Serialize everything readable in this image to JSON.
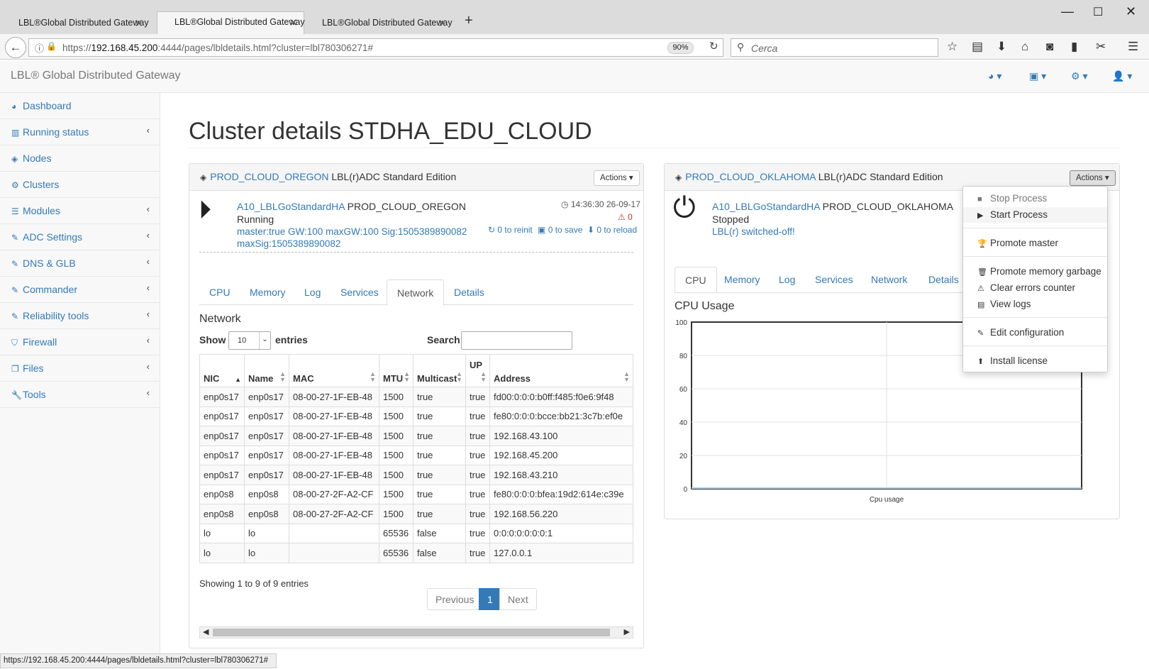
{
  "browser": {
    "tabs": [
      "LBL®Global Distributed Gateway",
      "LBL®Global Distributed Gateway",
      "LBL®Global Distributed Gateway"
    ],
    "url_prefix": "https://",
    "url_host": "192.168.45.200",
    "url_rest": ":4444/pages/lbldetails.html?cluster=lbl780306271#",
    "zoom": "90%",
    "search_placeholder": "Cerca",
    "status_url": "https://192.168.45.200:4444/pages/lbldetails.html?cluster=lbl780306271#"
  },
  "app": {
    "brand": "LBL® Global Distributed Gateway"
  },
  "sidebar": {
    "items": [
      {
        "label": "Dashboard",
        "icon": "dashboard-icon"
      },
      {
        "label": "Running status",
        "icon": "bar-chart-icon"
      },
      {
        "label": "Nodes",
        "icon": "cube-icon"
      },
      {
        "label": "Clusters",
        "icon": "cogs-icon"
      },
      {
        "label": "Modules",
        "icon": "list-icon"
      },
      {
        "label": "ADC Settings",
        "icon": "edit-icon"
      },
      {
        "label": "DNS & GLB",
        "icon": "edit-icon"
      },
      {
        "label": "Commander",
        "icon": "edit-icon"
      },
      {
        "label": "Reliability tools",
        "icon": "edit-icon"
      },
      {
        "label": "Firewall",
        "icon": "shield-icon"
      },
      {
        "label": "Files",
        "icon": "files-icon"
      },
      {
        "label": "Tools",
        "icon": "wrench-icon"
      }
    ]
  },
  "page": {
    "title": "Cluster details STDHA_EDU_CLOUD"
  },
  "left_panel": {
    "name": "PROD_CLOUD_OREGON",
    "edition": "LBL(r)ADC Standard Edition",
    "actions_label": "Actions",
    "node_link": "A10_LBLGoStandardHA",
    "node_name": "PROD_CLOUD_OREGON",
    "state": "Running",
    "info_line1": "master:true GW:100 maxGW:100 Sig:1505389890082",
    "info_line2": "maxSig:1505389890082",
    "timestamp": "14:36:30 26-09-17",
    "warnings": "0",
    "reinit": "0 to reinit",
    "save": "0 to save",
    "reload": "0 to reload",
    "tabs": [
      "CPU",
      "Memory",
      "Log",
      "Services",
      "Network",
      "Details"
    ],
    "section_title": "Network",
    "show_label": "Show",
    "entries_value": "10",
    "entries_label": "entries",
    "search_label": "Search:",
    "columns": [
      "NIC",
      "Name",
      "MAC",
      "MTU",
      "Multicast",
      "UP",
      "Address"
    ],
    "rows": [
      [
        "enp0s17",
        "enp0s17",
        "08-00-27-1F-EB-48",
        "1500",
        "true",
        "true",
        "fd00:0:0:0:b0ff:f485:f0e6:9f48"
      ],
      [
        "enp0s17",
        "enp0s17",
        "08-00-27-1F-EB-48",
        "1500",
        "true",
        "true",
        "fe80:0:0:0:bcce:bb21:3c7b:ef0e"
      ],
      [
        "enp0s17",
        "enp0s17",
        "08-00-27-1F-EB-48",
        "1500",
        "true",
        "true",
        "192.168.43.100"
      ],
      [
        "enp0s17",
        "enp0s17",
        "08-00-27-1F-EB-48",
        "1500",
        "true",
        "true",
        "192.168.45.200"
      ],
      [
        "enp0s17",
        "enp0s17",
        "08-00-27-1F-EB-48",
        "1500",
        "true",
        "true",
        "192.168.43.210"
      ],
      [
        "enp0s8",
        "enp0s8",
        "08-00-27-2F-A2-CF",
        "1500",
        "true",
        "true",
        "fe80:0:0:0:bfea:19d2:614e:c39e"
      ],
      [
        "enp0s8",
        "enp0s8",
        "08-00-27-2F-A2-CF",
        "1500",
        "true",
        "true",
        "192.168.56.220"
      ],
      [
        "lo",
        "lo",
        "",
        "65536",
        "false",
        "true",
        "0:0:0:0:0:0:0:1"
      ],
      [
        "lo",
        "lo",
        "",
        "65536",
        "false",
        "true",
        "127.0.0.1"
      ]
    ],
    "showing": "Showing 1 to 9 of 9 entries",
    "pager": {
      "previous": "Previous",
      "current": "1",
      "next": "Next"
    }
  },
  "right_panel": {
    "name": "PROD_CLOUD_OKLAHOMA",
    "edition": "LBL(r)ADC Standard Edition",
    "actions_label": "Actions",
    "node_link": "A10_LBLGoStandardHA",
    "node_name": "PROD_CLOUD_OKLAHOMA",
    "state": "Stopped",
    "info_line1": "LBL(r) switched-off!",
    "tabs": [
      "CPU",
      "Memory",
      "Log",
      "Services",
      "Network",
      "Details"
    ],
    "chart_title": "CPU Usage"
  },
  "dropdown": {
    "items": [
      {
        "label": "Stop Process",
        "icon": "stop-icon"
      },
      {
        "label": "Start Process",
        "icon": "play-icon"
      },
      {
        "label": "Promote master",
        "icon": "trophy-icon"
      },
      {
        "label": "Promote memory garbage",
        "icon": "trash-icon"
      },
      {
        "label": "Clear errors counter",
        "icon": "warning-icon"
      },
      {
        "label": "View logs",
        "icon": "file-icon"
      },
      {
        "label": "Edit configuration",
        "icon": "edit-icon"
      },
      {
        "label": "Install license",
        "icon": "upload-icon"
      }
    ]
  },
  "chart_data": {
    "type": "line",
    "title": "",
    "xlabel": "Cpu usage",
    "ylabel": "",
    "ylim": [
      0,
      100
    ],
    "yticks": [
      0,
      20,
      40,
      60,
      80,
      100
    ],
    "series": [],
    "grid": true
  },
  "colors": {
    "link": "#337ab7",
    "pager_active": "#337ab7",
    "warning": "#c0392b"
  }
}
